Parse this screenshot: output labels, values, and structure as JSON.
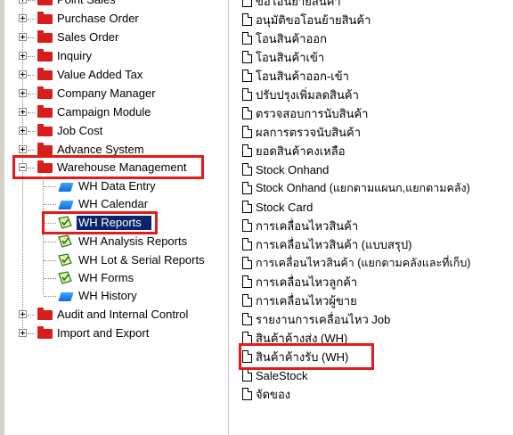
{
  "colors": {
    "highlight": "#e21b1b",
    "folder": "#d81d1d",
    "selection": "#0a246a",
    "selection_text": "#ffffff"
  },
  "tree": {
    "top_items": [
      {
        "label": "Point Sales",
        "icon": "red-folder-icon"
      },
      {
        "label": "Purchase Order",
        "icon": "red-folder-icon"
      },
      {
        "label": "Sales Order",
        "icon": "red-folder-icon"
      },
      {
        "label": "Inquiry",
        "icon": "red-folder-icon"
      },
      {
        "label": "Value Added Tax",
        "icon": "red-folder-icon"
      },
      {
        "label": "Company Manager",
        "icon": "red-folder-icon"
      },
      {
        "label": "Campaign Module",
        "icon": "red-folder-icon"
      },
      {
        "label": "Job Cost",
        "icon": "red-folder-icon"
      },
      {
        "label": "Advance System",
        "icon": "red-folder-icon"
      }
    ],
    "warehouse": {
      "label": "Warehouse Management",
      "expanded": true
    },
    "warehouse_children": [
      {
        "label": "WH Data Entry",
        "icon": "blue-folder-icon"
      },
      {
        "label": "WH Calendar",
        "icon": "blue-folder-icon"
      },
      {
        "label": "WH Reports",
        "icon": "report-icon",
        "selected": true
      },
      {
        "label": "WH Analysis Reports",
        "icon": "report-icon"
      },
      {
        "label": "WH Lot & Serial Reports",
        "icon": "report-icon"
      },
      {
        "label": "WH Forms",
        "icon": "report-icon"
      },
      {
        "label": "WH History",
        "icon": "blue-folder-icon"
      }
    ],
    "bottom_items": [
      {
        "label": "Audit and Internal Control",
        "icon": "red-folder-icon"
      },
      {
        "label": "Import and Export",
        "icon": "red-folder-icon"
      }
    ]
  },
  "reports": {
    "items": [
      {
        "label": "ขอโอนย้ายสินค้า",
        "icon": "document-icon"
      },
      {
        "label": "อนุมัติขอโอนย้ายสินค้า",
        "icon": "document-icon"
      },
      {
        "label": "โอนสินค้าออก",
        "icon": "document-icon"
      },
      {
        "label": "โอนสินค้าเข้า",
        "icon": "document-icon"
      },
      {
        "label": "โอนสินค้าออก-เข้า",
        "icon": "document-icon"
      },
      {
        "label": "ปรับปรุงเพิ่มลดสินค้า",
        "icon": "document-icon"
      },
      {
        "label": "ตรวจสอบการนับสินค้า",
        "icon": "document-icon"
      },
      {
        "label": "ผลการตรวจนับสินค้า",
        "icon": "document-icon"
      },
      {
        "label": "ยอดสินค้าคงเหลือ",
        "icon": "document-icon"
      },
      {
        "label": "Stock Onhand",
        "icon": "document-icon"
      },
      {
        "label": "Stock Onhand (แยกตามแผนก,แยกตามคลัง)",
        "icon": "document-icon"
      },
      {
        "label": "Stock Card",
        "icon": "document-icon"
      },
      {
        "label": "การเคลื่อนไหวสินค้า",
        "icon": "document-icon"
      },
      {
        "label": "การเคลื่อนไหวสินค้า (แบบสรุป)",
        "icon": "document-icon"
      },
      {
        "label": "การเคลื่อนไหวสินค้า (แยกตามคลังและที่เก็บ)",
        "icon": "document-icon"
      },
      {
        "label": "การเคลื่อนไหวลูกค้า",
        "icon": "document-icon"
      },
      {
        "label": "การเคลื่อนไหวผู้ขาย",
        "icon": "document-icon"
      },
      {
        "label": "รายงานการเคลื่อนไหว Job",
        "icon": "document-icon"
      },
      {
        "label": "สินค้าค้างส่ง (WH)",
        "icon": "document-icon"
      },
      {
        "label": "สินค้าค้างรับ (WH)",
        "icon": "document-icon",
        "highlighted": true
      },
      {
        "label": "SaleStock",
        "icon": "document-icon"
      },
      {
        "label": "จัดของ",
        "icon": "document-icon"
      }
    ]
  }
}
